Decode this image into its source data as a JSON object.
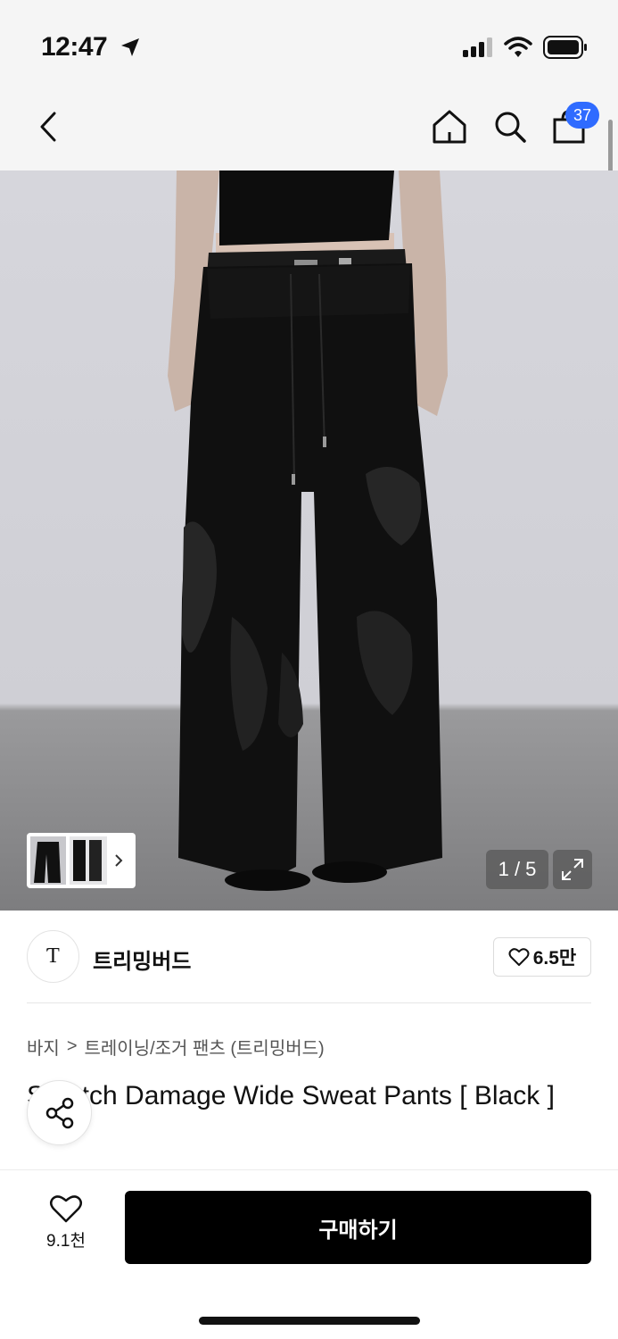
{
  "status": {
    "time": "12:47"
  },
  "nav": {
    "cart_count": "37"
  },
  "gallery": {
    "counter": "1 / 5",
    "current": 1,
    "total": 5
  },
  "brand": {
    "logo_text": "Ƭ",
    "name": "트리밍버드",
    "likes": "6.5만"
  },
  "breadcrumb": {
    "category": "바지",
    "separator": ">",
    "subcategory": "트레이닝/조거 팬츠 (트리밍버드)"
  },
  "product": {
    "title": "Scratch Damage Wide Sweat Pants [ Black ]"
  },
  "bottom": {
    "wish_count": "9.1천",
    "buy_label": "구매하기"
  },
  "colors": {
    "accent": "#2f6bff",
    "buy_button": "#000000",
    "nav_bg": "#f5f5f5"
  },
  "icons": [
    "back-icon",
    "home-icon",
    "search-icon",
    "cart-icon",
    "location-arrow-icon",
    "signal-icon",
    "wifi-icon",
    "battery-icon",
    "expand-icon",
    "heart-icon",
    "share-icon",
    "chevron-right-icon"
  ]
}
